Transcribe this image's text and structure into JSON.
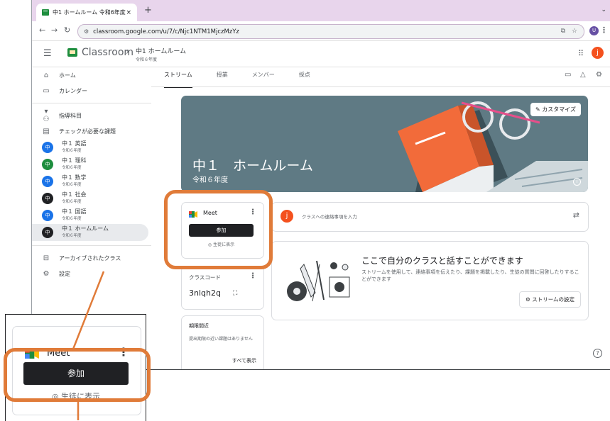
{
  "browser": {
    "tab_title": "中1 ホームルーム 令和6年度",
    "tab_close": "×",
    "new_tab": "+",
    "url": "classroom.google.com/u/7/c/Njc1NTM1MjczMzYz",
    "profile_initial": "U"
  },
  "app": {
    "name": "Classroom",
    "class_name": "中1 ホームルーム",
    "class_section": "令和６年度",
    "user_initial": "j"
  },
  "sidebar": {
    "home": "ホーム",
    "calendar": "カレンダー",
    "teaching": "指導科目",
    "todo": "チェックが必要な課題",
    "courses": [
      {
        "initial": "中",
        "name": "中１ 英語",
        "sub": "令和６年度",
        "color": "#1a73e8"
      },
      {
        "initial": "中",
        "name": "中１ 理科",
        "sub": "令和６年度",
        "color": "#1e8e3e"
      },
      {
        "initial": "中",
        "name": "中１ 数学",
        "sub": "令和６年度",
        "color": "#1a73e8"
      },
      {
        "initial": "中",
        "name": "中１ 社会",
        "sub": "令和６年度",
        "color": "#202124"
      },
      {
        "initial": "中",
        "name": "中１ 国語",
        "sub": "令和６年度",
        "color": "#1a73e8"
      },
      {
        "initial": "中",
        "name": "中１ ホームルーム",
        "sub": "令和６年度",
        "color": "#202124"
      }
    ],
    "archived": "アーカイブされたクラス",
    "settings": "設定"
  },
  "tabs": [
    "ストリーム",
    "授業",
    "メンバー",
    "採点"
  ],
  "banner": {
    "title": "中１　ホームルーム",
    "subtitle": "令和６年度",
    "customize": "カスタマイズ"
  },
  "meet": {
    "label": "Meet",
    "join": "参加",
    "show_students": "生徒に表示"
  },
  "class_code": {
    "label": "クラスコード",
    "value": "3nlqh2q"
  },
  "upcoming": {
    "title": "期限間近",
    "empty": "提出期限の近い課題はありません",
    "view_all": "すべて表示"
  },
  "post": {
    "placeholder": "クラスへの連絡事項を入力"
  },
  "empty_state": {
    "heading": "ここで自分のクラスと話すことができます",
    "description": "ストリームを使用して、連絡事項を伝えたり、課題を掲載したり、生徒の質問に回答したりすることができます",
    "settings_button": "ストリームの設定"
  },
  "colors": {
    "accent_orange": "#e07b39",
    "banner": "#5f7a84",
    "tab_strip": "#e8d5ec"
  }
}
